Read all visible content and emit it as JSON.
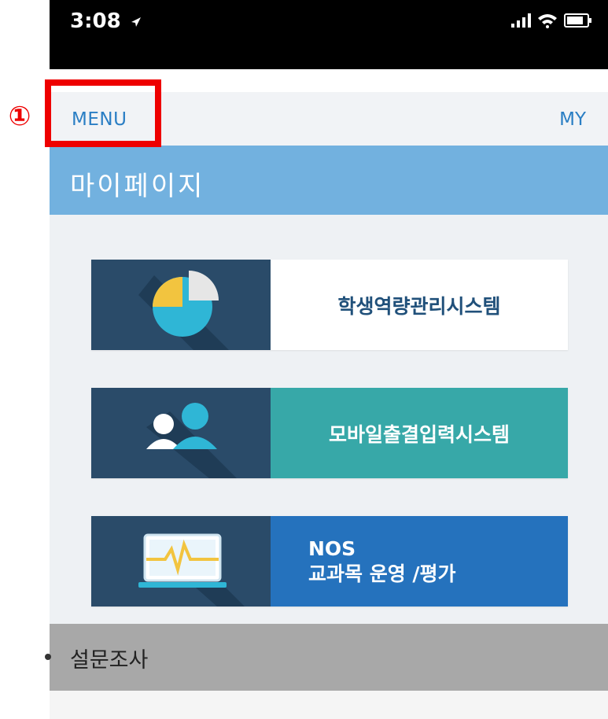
{
  "status_bar": {
    "time": "3:08"
  },
  "navbar": {
    "menu_label": "MENU",
    "my_label": "MY"
  },
  "annotation": {
    "step": "①"
  },
  "page_title": "마이페이지",
  "cards": [
    {
      "label": "학생역량관리시스템",
      "icon": "pie-chart-icon",
      "color": "#ffffff"
    },
    {
      "label": "모바일출결입력시스템",
      "icon": "users-icon",
      "color": "#37a8a8"
    },
    {
      "label_line1": "NOS",
      "label_line2": "교과목 운영 /평가",
      "icon": "monitor-pulse-icon",
      "color": "#2572bd"
    }
  ],
  "survey": {
    "label": "설문조사"
  },
  "colors": {
    "accent": "#2a7ec4",
    "header": "#72b1df",
    "highlight": "#ee0000"
  }
}
